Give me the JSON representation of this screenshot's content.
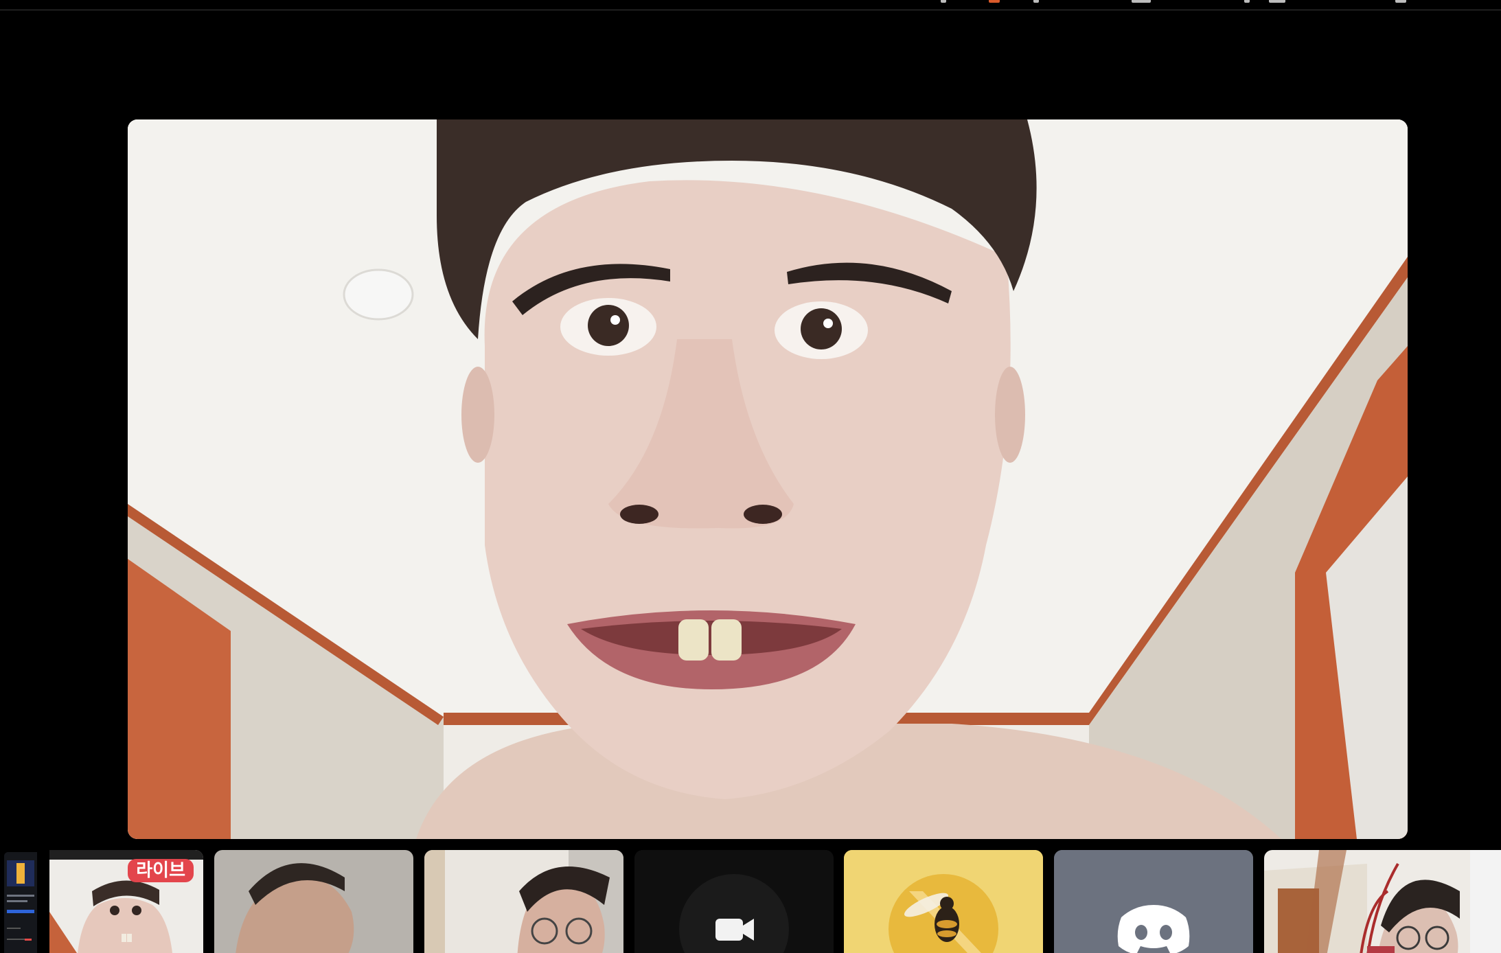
{
  "tiles": {
    "live_badge": "라이브"
  },
  "icons": {
    "video_icon": "video-camera-icon",
    "discord_icon": "discord-logo-icon"
  },
  "colors": {
    "background": "#000000",
    "live_badge": "#e3454c",
    "discord_tile": "#6c727f",
    "bee_tile": "#f0d573",
    "dark_tile": "#0f0f0f"
  }
}
